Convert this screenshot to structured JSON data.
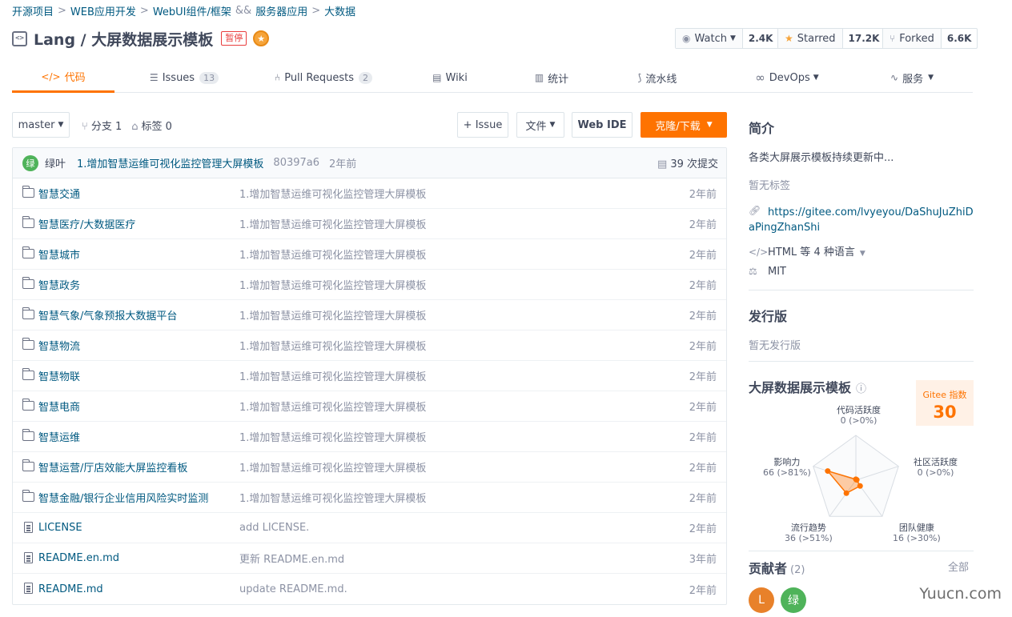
{
  "breadcrumb": [
    "开源项目",
    "WEB应用开发",
    "WebUI组件/框架",
    "服务器应用",
    "大数据"
  ],
  "breadcrumb_seps": [
    ">",
    ">",
    "&&",
    ">"
  ],
  "repo": {
    "title": "Lang / 大屏数据展示模板",
    "status_badge": "暂停",
    "code_icon": "<>"
  },
  "social": {
    "watch_label": "Watch",
    "watch_count": "2.4K",
    "star_label": "Starred",
    "star_count": "17.2K",
    "fork_label": "Forked",
    "fork_count": "6.6K"
  },
  "tabs": [
    {
      "label": "代码",
      "icon": "code-icon"
    },
    {
      "label": "Issues",
      "icon": "issues-icon",
      "count": "13"
    },
    {
      "label": "Pull Requests",
      "icon": "pull-request-icon",
      "count": "2"
    },
    {
      "label": "Wiki",
      "icon": "wiki-icon"
    },
    {
      "label": "统计",
      "icon": "stats-icon"
    },
    {
      "label": "流水线",
      "icon": "pipeline-icon"
    },
    {
      "label": "DevOps",
      "icon": "devops-icon"
    },
    {
      "label": "服务",
      "icon": "service-icon"
    }
  ],
  "toolbar": {
    "branch": "master",
    "branches": "分支 1",
    "tags": "标签 0",
    "issue_btn": "+ Issue",
    "file_btn": "文件",
    "webide_btn": "Web IDE",
    "clone_btn": "克隆/下载"
  },
  "commit": {
    "avatar": "绿",
    "author": "绿叶",
    "message": "1.增加智慧运维可视化监控管理大屏模板",
    "hash": "80397a6",
    "time": "2年前",
    "count": "39 次提交"
  },
  "files": [
    {
      "type": "folder",
      "name": "智慧交通",
      "msg": "1.增加智慧运维可视化监控管理大屏模板",
      "time": "2年前"
    },
    {
      "type": "folder",
      "name": "智慧医疗/大数据医疗",
      "msg": "1.增加智慧运维可视化监控管理大屏模板",
      "time": "2年前"
    },
    {
      "type": "folder",
      "name": "智慧城市",
      "msg": "1.增加智慧运维可视化监控管理大屏模板",
      "time": "2年前"
    },
    {
      "type": "folder",
      "name": "智慧政务",
      "msg": "1.增加智慧运维可视化监控管理大屏模板",
      "time": "2年前"
    },
    {
      "type": "folder",
      "name": "智慧气象/气象预报大数据平台",
      "msg": "1.增加智慧运维可视化监控管理大屏模板",
      "time": "2年前"
    },
    {
      "type": "folder",
      "name": "智慧物流",
      "msg": "1.增加智慧运维可视化监控管理大屏模板",
      "time": "2年前"
    },
    {
      "type": "folder",
      "name": "智慧物联",
      "msg": "1.增加智慧运维可视化监控管理大屏模板",
      "time": "2年前"
    },
    {
      "type": "folder",
      "name": "智慧电商",
      "msg": "1.增加智慧运维可视化监控管理大屏模板",
      "time": "2年前"
    },
    {
      "type": "folder",
      "name": "智慧运维",
      "msg": "1.增加智慧运维可视化监控管理大屏模板",
      "time": "2年前"
    },
    {
      "type": "folder",
      "name": "智慧运营/厅店效能大屏监控看板",
      "msg": "1.增加智慧运维可视化监控管理大屏模板",
      "time": "2年前"
    },
    {
      "type": "folder",
      "name": "智慧金融/银行企业信用风险实时监测",
      "msg": "1.增加智慧运维可视化监控管理大屏模板",
      "time": "2年前"
    },
    {
      "type": "file",
      "name": "LICENSE",
      "msg": "add LICENSE.",
      "time": "2年前"
    },
    {
      "type": "file",
      "name": "README.en.md",
      "msg": "更新 README.en.md",
      "time": "3年前"
    },
    {
      "type": "file",
      "name": "README.md",
      "msg": "update README.md.",
      "time": "2年前"
    }
  ],
  "sidebar": {
    "intro_title": "简介",
    "intro_text": "各类大屏展示模板持续更新中...",
    "no_tags": "暂无标签",
    "url": "https://gitee.com/lvyeyou/DaShuJuZhiDaPingZhanShi",
    "language": "HTML 等 4 种语言",
    "license": "MIT",
    "release_title": "发行版",
    "no_release": "暂无发行版",
    "index_title": "大屏数据展示模板",
    "gitee_index_label": "Gitee 指数",
    "gitee_index_value": "30",
    "radar": [
      {
        "name": "代码活跃度",
        "value": "0 (>0%)",
        "score": 0
      },
      {
        "name": "社区活跃度",
        "value": "0 (>0%)",
        "score": 0
      },
      {
        "name": "团队健康",
        "value": "16 (>30%)",
        "score": 16
      },
      {
        "name": "流行趋势",
        "value": "36 (>51%)",
        "score": 36
      },
      {
        "name": "影响力",
        "value": "66 (>81%)",
        "score": 66
      }
    ],
    "contributors_title": "贡献者",
    "contributors_count": "(2)",
    "contributors_all": "全部",
    "contributors": [
      {
        "initial": "L",
        "color": "#e8812a"
      },
      {
        "initial": "绿",
        "color": "#4fb35a"
      }
    ]
  },
  "watermark": "Yuucn.com",
  "colors": {
    "accent": "#fe7300",
    "link": "#005980"
  }
}
